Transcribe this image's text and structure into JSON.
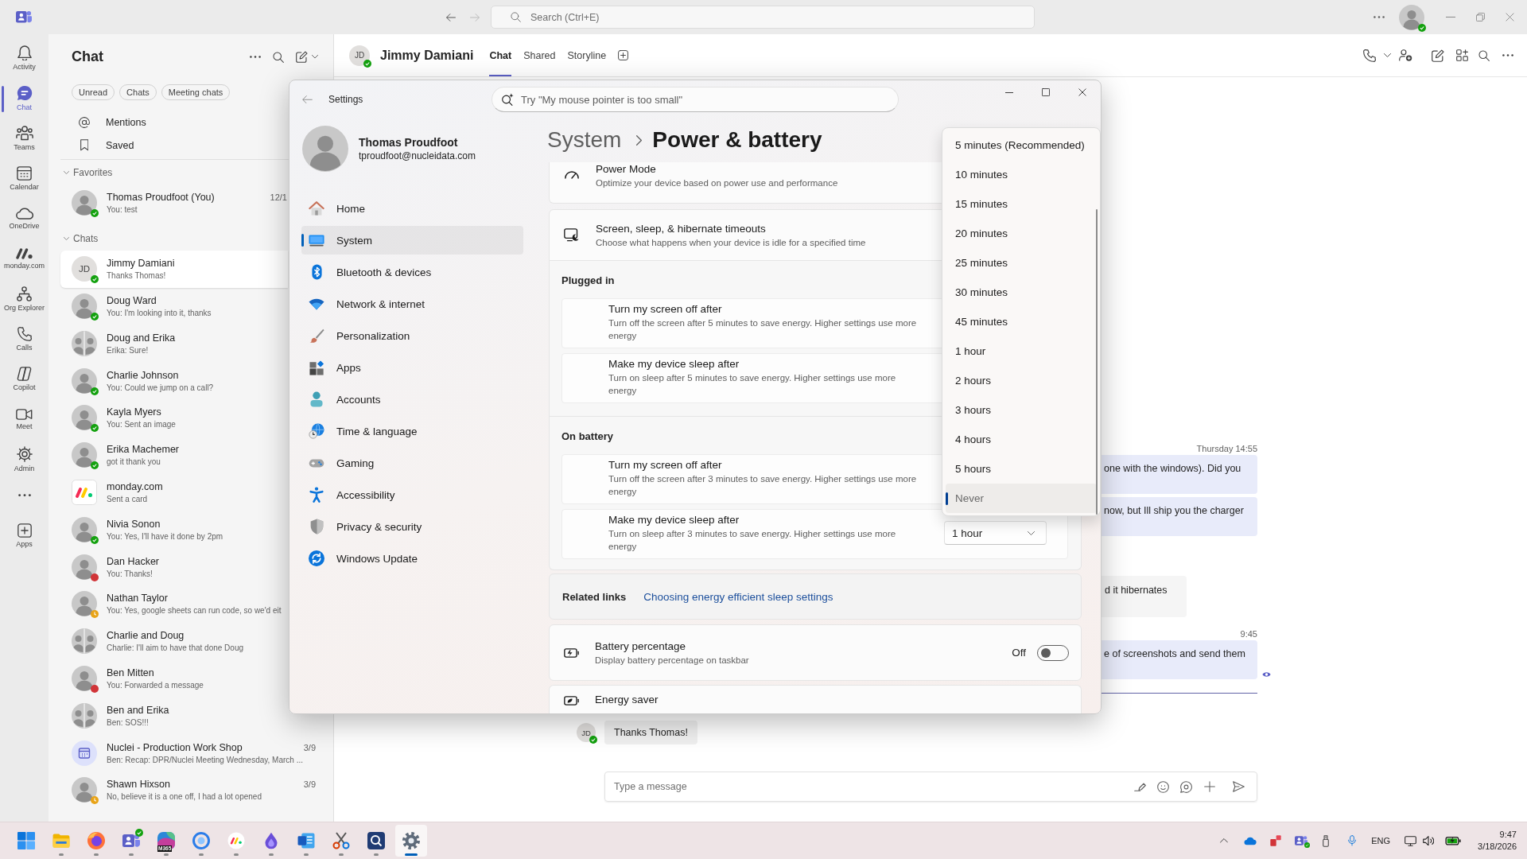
{
  "title_bar": {
    "search": {
      "placeholder": "Search (Ctrl+E)"
    },
    "account": {
      "status": {
        "kind": "available",
        "color": "#13a10e"
      }
    }
  },
  "app_rail": {
    "items": [
      {
        "label": "Activity",
        "selected": false
      },
      {
        "label": "Chat",
        "selected": true
      },
      {
        "label": "Teams",
        "selected": false
      },
      {
        "label": "Calendar",
        "selected": false
      },
      {
        "label": "OneDrive",
        "selected": false
      },
      {
        "label": "monday.com",
        "selected": false
      },
      {
        "label": "Org Explorer",
        "selected": false
      },
      {
        "label": "Calls",
        "selected": false
      },
      {
        "label": "Copilot",
        "selected": false
      },
      {
        "label": "Meet",
        "selected": false
      },
      {
        "label": "Admin",
        "selected": false
      }
    ],
    "apps": {
      "label": "Apps",
      "selected": false
    }
  },
  "chat_list": {
    "title": "Chat",
    "filters": [
      {
        "label": "Unread",
        "selected": false
      },
      {
        "label": "Chats",
        "selected": false
      },
      {
        "label": "Meeting chats",
        "selected": false
      }
    ],
    "shortcuts": [
      "Mentions",
      "Saved"
    ],
    "sections": [
      {
        "title": "Favorites",
        "expanded": true,
        "chats": [
          {
            "kind": "photo",
            "name": "Thomas Proudfoot (You)",
            "preview": "You: test",
            "date": "12/1",
            "status": {
              "kind": "available",
              "color": "#13a10e"
            },
            "selected": false
          }
        ]
      },
      {
        "title": "Chats",
        "expanded": true,
        "chats": [
          {
            "kind": "initials",
            "initials": "JD",
            "name": "Jimmy Damiani",
            "preview": "Thanks Thomas!",
            "status": {
              "kind": "available",
              "color": "#13a10e"
            },
            "selected": true
          },
          {
            "kind": "photo",
            "name": "Doug Ward",
            "preview": "You: I'm looking into it, thanks",
            "status": {
              "kind": "available",
              "color": "#13a10e"
            },
            "selected": false
          },
          {
            "kind": "group",
            "name": "Doug and Erika",
            "preview": "Erika: Sure!",
            "selected": false
          },
          {
            "kind": "photo",
            "name": "Charlie Johnson",
            "preview": "You: Could we jump on a call?",
            "status": {
              "kind": "available",
              "color": "#13a10e"
            },
            "selected": false
          },
          {
            "kind": "photo",
            "name": "Kayla Myers",
            "preview": "You: Sent an image",
            "status": {
              "kind": "available",
              "color": "#13a10e"
            },
            "selected": false
          },
          {
            "kind": "photo",
            "name": "Erika Machemer",
            "preview": "got it thank you",
            "status": {
              "kind": "available",
              "color": "#13a10e"
            },
            "selected": false
          },
          {
            "kind": "app",
            "name": "monday.com",
            "preview": "Sent a card",
            "selected": false
          },
          {
            "kind": "photo",
            "name": "Nivia Sonon",
            "preview": "You: Yes, I'll have it done by 2pm",
            "status": {
              "kind": "available",
              "color": "#13a10e"
            },
            "selected": false
          },
          {
            "kind": "photo",
            "name": "Dan Hacker",
            "preview": "You: Thanks!",
            "status": {
              "kind": "busy",
              "color": "#d13438"
            },
            "selected": false
          },
          {
            "kind": "photo",
            "name": "Nathan Taylor",
            "preview": "You: Yes, google sheets can run code, so we'd eit",
            "status": {
              "kind": "away",
              "color": "#e8a317"
            },
            "selected": false
          },
          {
            "kind": "group",
            "name": "Charlie and Doug",
            "preview": "Charlie: I'll aim to have that done Doug",
            "selected": false
          },
          {
            "kind": "photo",
            "name": "Ben Mitten",
            "preview": "You: Forwarded a message",
            "status": {
              "kind": "busy",
              "color": "#d13438"
            },
            "selected": false
          },
          {
            "kind": "group",
            "name": "Ben and Erika",
            "preview": "Ben: SOS!!!",
            "selected": false
          },
          {
            "kind": "meeting",
            "name": "Nuclei - Production Work Shop",
            "preview": "Ben: Recap: DPR/Nuclei Meeting Wednesday, March ...",
            "date": "3/9",
            "selected": false
          },
          {
            "kind": "photo",
            "name": "Shawn Hixson",
            "preview": "No, believe it is a one off, I had a lot opened",
            "date": "3/9",
            "status": {
              "kind": "away",
              "color": "#e8a317"
            },
            "selected": false
          }
        ]
      }
    ]
  },
  "conversation": {
    "header": {
      "initials": "JD",
      "status": {
        "kind": "available",
        "color": "#13a10e"
      },
      "name": "Jimmy Damiani",
      "tabs": [
        {
          "label": "Chat",
          "selected": true
        },
        {
          "label": "Shared",
          "selected": false
        },
        {
          "label": "Storyline",
          "selected": false
        }
      ]
    },
    "messages": [
      {
        "kind": "timestamp",
        "text": "Thursday 14:55"
      },
      {
        "kind": "sent",
        "text": "one with the windows). Did you",
        "read": false
      },
      {
        "kind": "sent",
        "text": "now, but Ill ship you the charger",
        "read": false
      },
      {
        "kind": "received",
        "text": "d it hibernates"
      },
      {
        "kind": "timestamp",
        "text": "9:45"
      },
      {
        "kind": "sent",
        "text": "e of screenshots and send them",
        "read": true
      }
    ],
    "latest": {
      "initials": "JD",
      "status": {
        "kind": "available",
        "color": "#13a10e"
      },
      "text": "Thanks Thomas!"
    },
    "composer": {
      "placeholder": "Type a message"
    }
  },
  "settings_window": {
    "title": "Settings",
    "search": {
      "placeholder": "Try \"My mouse pointer is too small\""
    },
    "profile": {
      "name": "Thomas Proudfoot",
      "email": "tproudfoot@nucleidata.com"
    },
    "nav": [
      {
        "label": "Home",
        "selected": false
      },
      {
        "label": "System",
        "selected": true
      },
      {
        "label": "Bluetooth & devices",
        "selected": false
      },
      {
        "label": "Network & internet",
        "selected": false
      },
      {
        "label": "Personalization",
        "selected": false
      },
      {
        "label": "Apps",
        "selected": false
      },
      {
        "label": "Accounts",
        "selected": false
      },
      {
        "label": "Time & language",
        "selected": false
      },
      {
        "label": "Gaming",
        "selected": false
      },
      {
        "label": "Accessibility",
        "selected": false
      },
      {
        "label": "Privacy & security",
        "selected": false
      },
      {
        "label": "Windows Update",
        "selected": false
      }
    ],
    "breadcrumb": [
      "System",
      "Power & battery"
    ],
    "power_mode": {
      "title": "Power Mode",
      "description": "Optimize your device based on power use and performance"
    },
    "timeouts": {
      "title": "Screen, sleep, & hibernate timeouts",
      "description": "Choose what happens when your device is idle for a specified time",
      "expanded": true,
      "groups": [
        {
          "title": "Plugged in",
          "rows": [
            {
              "title": "Turn my screen off after",
              "description": "Turn off the screen after 5 minutes to save energy. Higher settings use more energy"
            },
            {
              "title": "Make my device sleep after",
              "description": "Turn on sleep after 5 minutes to save energy. Higher settings use more energy"
            }
          ]
        },
        {
          "title": "On battery",
          "rows": [
            {
              "title": "Turn my screen off after",
              "description": "Turn off the screen after 3 minutes to save energy. Higher settings use more energy"
            },
            {
              "title": "Make my device sleep after",
              "description": "Turn on sleep after 3 minutes to save energy. Higher settings use more energy",
              "value": "1 hour"
            }
          ]
        }
      ]
    },
    "related_links": {
      "title": "Related links",
      "links": [
        "Choosing energy efficient sleep settings"
      ]
    },
    "battery_percentage": {
      "title": "Battery percentage",
      "description": "Display battery percentage on taskbar",
      "state_label": "Off",
      "on": false
    },
    "energy_saver": {
      "title": "Energy saver"
    },
    "dropdown_menu": {
      "options": [
        {
          "label": "5 minutes (Recommended)",
          "selected": false
        },
        {
          "label": "10 minutes",
          "selected": false
        },
        {
          "label": "15 minutes",
          "selected": false
        },
        {
          "label": "20 minutes",
          "selected": false
        },
        {
          "label": "25 minutes",
          "selected": false
        },
        {
          "label": "30 minutes",
          "selected": false
        },
        {
          "label": "45 minutes",
          "selected": false
        },
        {
          "label": "1 hour",
          "selected": false
        },
        {
          "label": "2 hours",
          "selected": false
        },
        {
          "label": "3 hours",
          "selected": false
        },
        {
          "label": "4 hours",
          "selected": false
        },
        {
          "label": "5 hours",
          "selected": false
        },
        {
          "label": "Never",
          "selected": true
        }
      ]
    }
  },
  "taskbar": {
    "apps": [
      {
        "running": false,
        "selected": false
      },
      {
        "running": true,
        "selected": false
      },
      {
        "running": true,
        "selected": false
      },
      {
        "running": true,
        "selected": false,
        "status": {
          "kind": "available",
          "color": "#13a10e"
        }
      },
      {
        "running": true,
        "selected": false,
        "label": "M365"
      },
      {
        "running": true,
        "selected": false
      },
      {
        "running": true,
        "selected": false
      },
      {
        "running": true,
        "selected": false
      },
      {
        "running": true,
        "selected": false
      },
      {
        "running": true,
        "selected": false
      },
      {
        "running": true,
        "selected": false
      },
      {
        "running": true,
        "selected": true
      }
    ],
    "tray": {
      "status": {
        "kind": "available",
        "color": "#13a10e"
      },
      "language": "ENG",
      "time": "9:47",
      "date": "3/18/2026"
    }
  }
}
